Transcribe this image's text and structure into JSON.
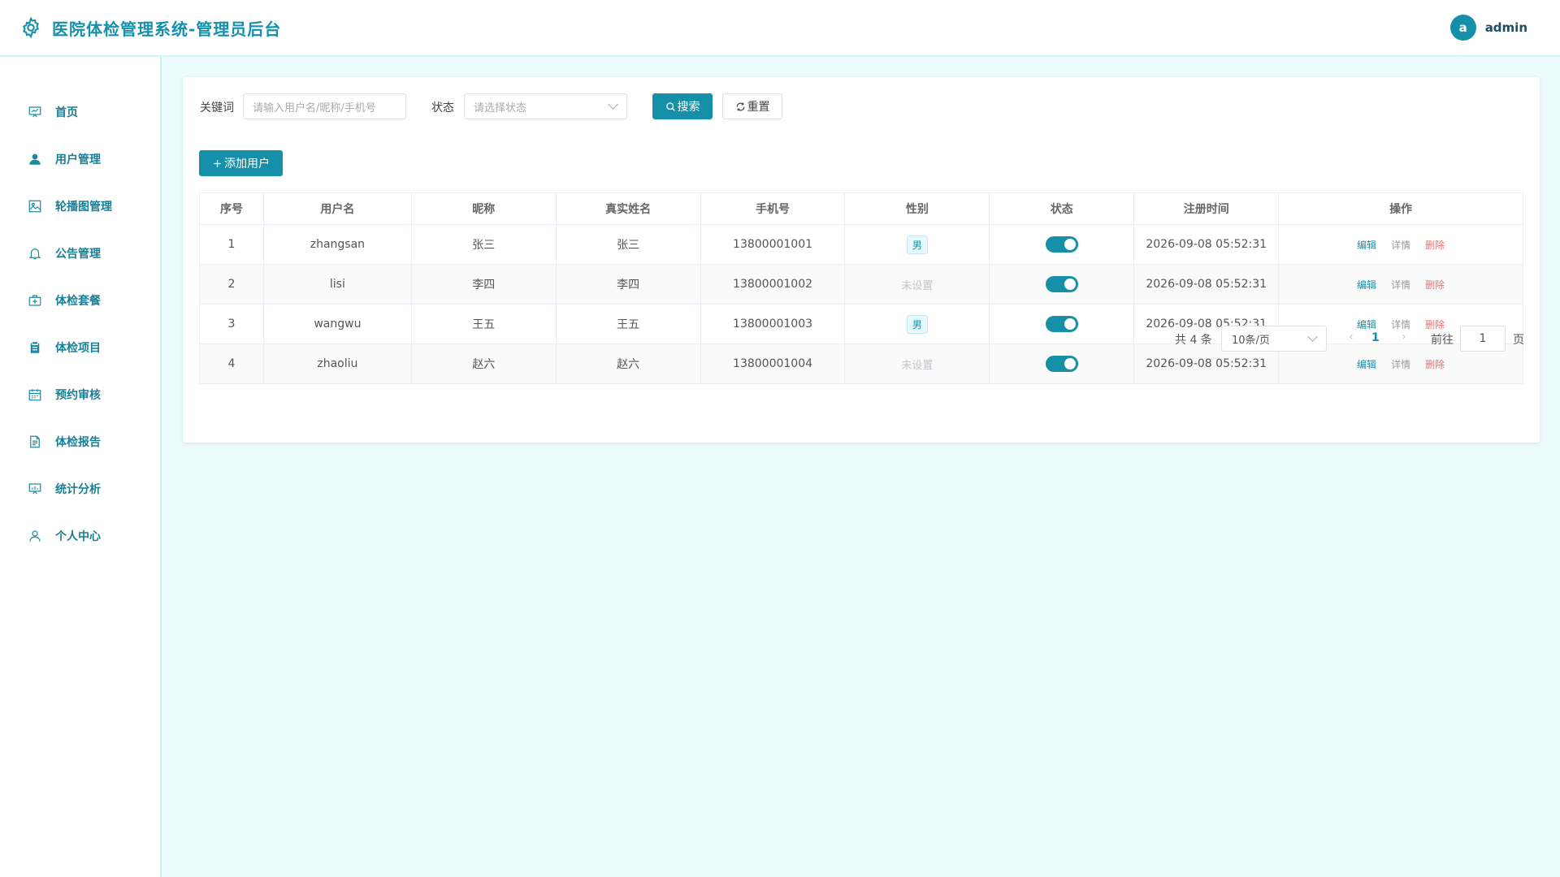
{
  "header": {
    "title": "医院体检管理系统-管理员后台",
    "avatar_letter": "a",
    "username": "admin"
  },
  "sidebar": {
    "items": [
      {
        "label": "首页",
        "icon": "dashboard-icon"
      },
      {
        "label": "用户管理",
        "icon": "user-icon"
      },
      {
        "label": "轮播图管理",
        "icon": "image-icon"
      },
      {
        "label": "公告管理",
        "icon": "bell-icon"
      },
      {
        "label": "体检套餐",
        "icon": "medical-kit-icon"
      },
      {
        "label": "体检项目",
        "icon": "clipboard-icon"
      },
      {
        "label": "预约审核",
        "icon": "calendar-icon"
      },
      {
        "label": "体检报告",
        "icon": "document-icon"
      },
      {
        "label": "统计分析",
        "icon": "chart-board-icon"
      },
      {
        "label": "个人中心",
        "icon": "person-icon"
      }
    ]
  },
  "search": {
    "keyword_label": "关键词",
    "keyword_placeholder": "请输入用户名/昵称/手机号",
    "status_label": "状态",
    "status_placeholder": "请选择状态",
    "search_button": "搜索",
    "reset_button": "重置"
  },
  "toolbar": {
    "add_button": "添加用户"
  },
  "table": {
    "columns": [
      "序号",
      "用户名",
      "昵称",
      "真实姓名",
      "手机号",
      "性别",
      "状态",
      "注册时间",
      "操作"
    ],
    "rows": [
      {
        "index": "1",
        "username": "zhangsan",
        "nickname": "张三",
        "realname": "张三",
        "phone": "13800001001",
        "gender": "男",
        "gender_set": true,
        "status_on": true,
        "reg_time": "2026-09-08 05:52:31"
      },
      {
        "index": "2",
        "username": "lisi",
        "nickname": "李四",
        "realname": "李四",
        "phone": "13800001002",
        "gender": "未设置",
        "gender_set": false,
        "status_on": true,
        "reg_time": "2026-09-08 05:52:31"
      },
      {
        "index": "3",
        "username": "wangwu",
        "nickname": "王五",
        "realname": "王五",
        "phone": "13800001003",
        "gender": "男",
        "gender_set": true,
        "status_on": true,
        "reg_time": "2026-09-08 05:52:31"
      },
      {
        "index": "4",
        "username": "zhaoliu",
        "nickname": "赵六",
        "realname": "赵六",
        "phone": "13800001004",
        "gender": "未设置",
        "gender_set": false,
        "status_on": true,
        "reg_time": "2026-09-08 05:52:31"
      }
    ],
    "actions": {
      "edit": "编辑",
      "detail": "详情",
      "delete": "删除"
    }
  },
  "pagination": {
    "total_text": "共 4 条",
    "page_size": "10条/页",
    "current_page": "1",
    "goto_label": "前往",
    "goto_value": "1",
    "page_suffix": "页"
  },
  "colors": {
    "primary": "#1590a8",
    "danger": "#f56c6c",
    "background": "#ebfbfd"
  }
}
